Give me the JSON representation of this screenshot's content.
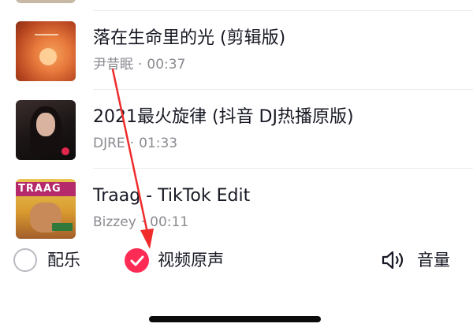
{
  "songs": [
    {
      "title": "落在生命里的光 (剪辑版)",
      "artist": "尹昔眠",
      "duration": "00:37",
      "cover_icon": "sunset-album-cover"
    },
    {
      "title": "2021最火旋律 (抖音 DJ热播原版)",
      "artist": "DJRE",
      "duration": "01:33",
      "cover_icon": "portrait-album-cover"
    },
    {
      "title": "Traag - TikTok Edit",
      "artist": "Bizzey",
      "duration": "00:11",
      "cover_icon": "traag-album-cover",
      "cover_text": "TRAAG"
    }
  ],
  "controls": {
    "music_label": "配乐",
    "music_checked": false,
    "original_sound_label": "视频原声",
    "original_sound_checked": true,
    "volume_label": "音量"
  },
  "colors": {
    "accent": "#fe2c55",
    "annotation_arrow": "#ef2b2b",
    "meta_text": "#8a8b91",
    "primary_text": "#161823"
  }
}
